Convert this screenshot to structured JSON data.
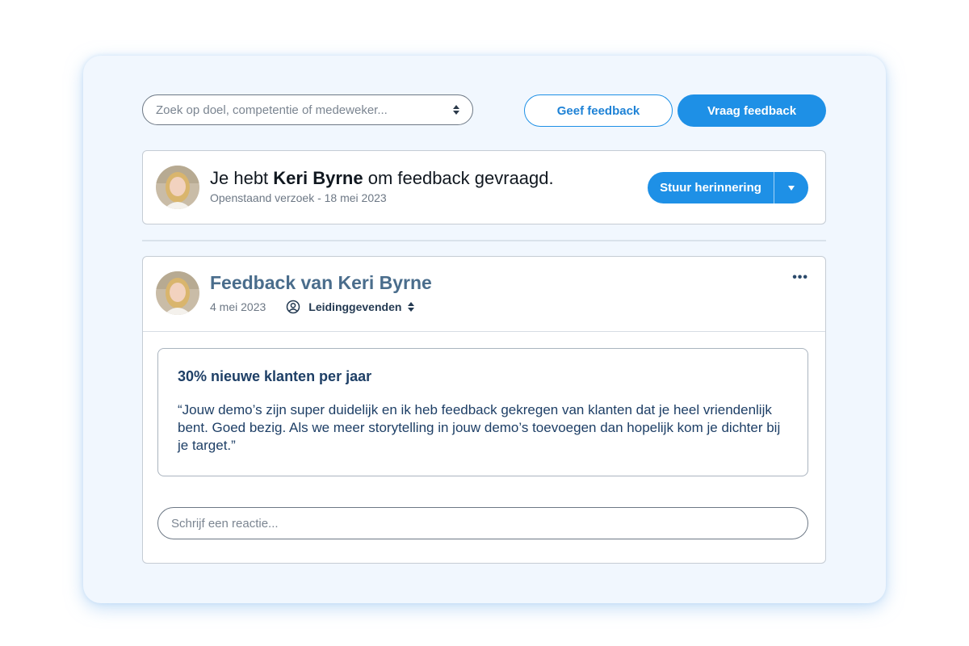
{
  "toolbar": {
    "search_placeholder": "Zoek op doel, competentie of medeweker...",
    "give_feedback_label": "Geef feedback",
    "ask_feedback_label": "Vraag feedback"
  },
  "request": {
    "title_prefix": "Je hebt",
    "name": "Keri Byrne",
    "title_suffix": "om feedback gevraagd.",
    "subtitle": "Openstaand verzoek - 18 mei 2023",
    "reminder_label": "Stuur herinnering"
  },
  "feedback": {
    "title": "Feedback van Keri Byrne",
    "date": "4 mei 2023",
    "visibility": "Leidinggevenden",
    "goal_title": "30% nieuwe klanten per jaar",
    "quote": "“Jouw demo’s zijn super duidelijk en ik heb feedback gekregen van klanten dat je heel vriendenlijk bent. Goed bezig. Als we meer storytelling in jouw demo’s toevoegen dan hopelijk kom je dichter bij je target.”",
    "reply_placeholder": "Schrijf een reactie..."
  },
  "colors": {
    "primary": "#1e90e6",
    "frame_bg": "#f1f7fe",
    "title_blue": "#4a6d8c",
    "goal_text": "#1e3f66"
  },
  "icons": {
    "sort": "sort-icon",
    "caret": "chevron-down-icon",
    "more": "more-icon",
    "visibility": "user-circle-icon"
  }
}
